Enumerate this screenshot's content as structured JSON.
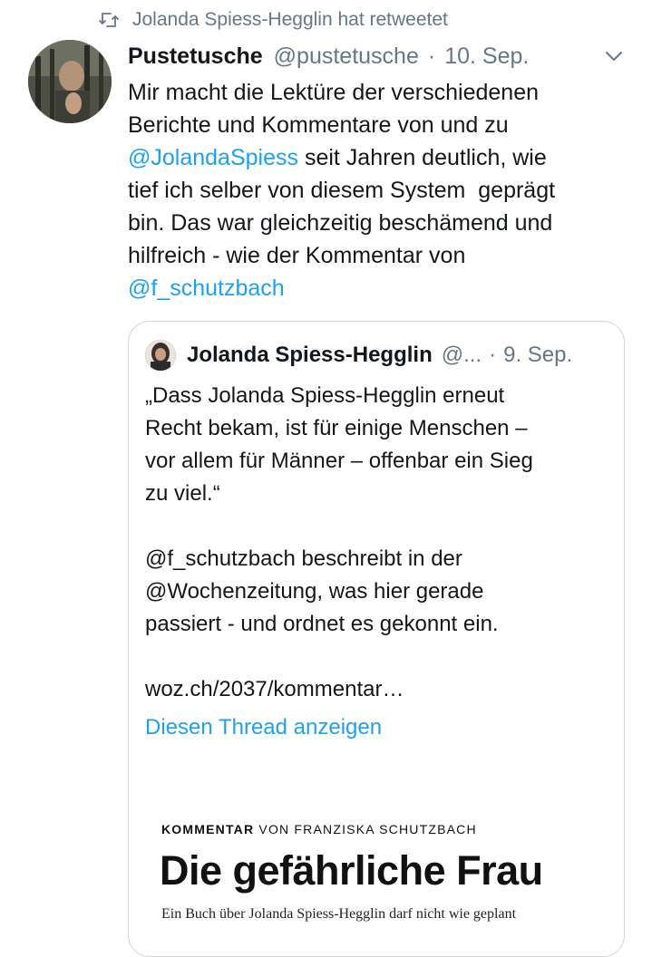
{
  "retweet": {
    "icon": "retweet-icon",
    "text": "Jolanda Spiess-Hegglin hat retweetet"
  },
  "tweet": {
    "author_name": "Pustetusche",
    "author_handle": "@pustetusche",
    "separator": "·",
    "date": "10. Sep.",
    "menu_icon": "chevron-down-icon",
    "text_parts": {
      "p1": "Mir macht die Lektüre der verschiedenen\nBerichte und Kommentare von und zu\n",
      "mention1": "@JolandaSpiess",
      "p2": " seit Jahren deutlich, wie\ntief ich selber von diesem System  geprägt\nbin. Das war gleichzeitig beschämend und\nhilfreich - wie der Kommentar von\n",
      "mention2": "@f_schutzbach"
    }
  },
  "quote": {
    "author_name": "Jolanda Spiess-Hegglin",
    "author_handle": "@...",
    "separator": "·",
    "date": "9. Sep.",
    "text": "„Dass Jolanda Spiess-Hegglin erneut\nRecht bekam, ist für einige Menschen –\nvor allem für Männer – offenbar ein Sieg\nzu viel.“\n\n@f_schutzbach beschreibt in der\n@Wochenzeitung, was hier gerade\npassiert - und ordnet es gekonnt ein.\n\nwoz.ch/2037/kommentar…",
    "thread_link": "Diesen Thread anzeigen",
    "article": {
      "kicker_bold": "KOMMENTAR",
      "kicker_rest": " VON FRANZISKA SCHUTZBACH",
      "headline": "Die gefährliche Frau",
      "lead": "Ein Buch über Jolanda Spiess-Hegglin darf nicht wie geplant"
    }
  },
  "colors": {
    "accent": "#1da1f2",
    "secondary_text": "#657786",
    "border": "#ccd6dd"
  }
}
